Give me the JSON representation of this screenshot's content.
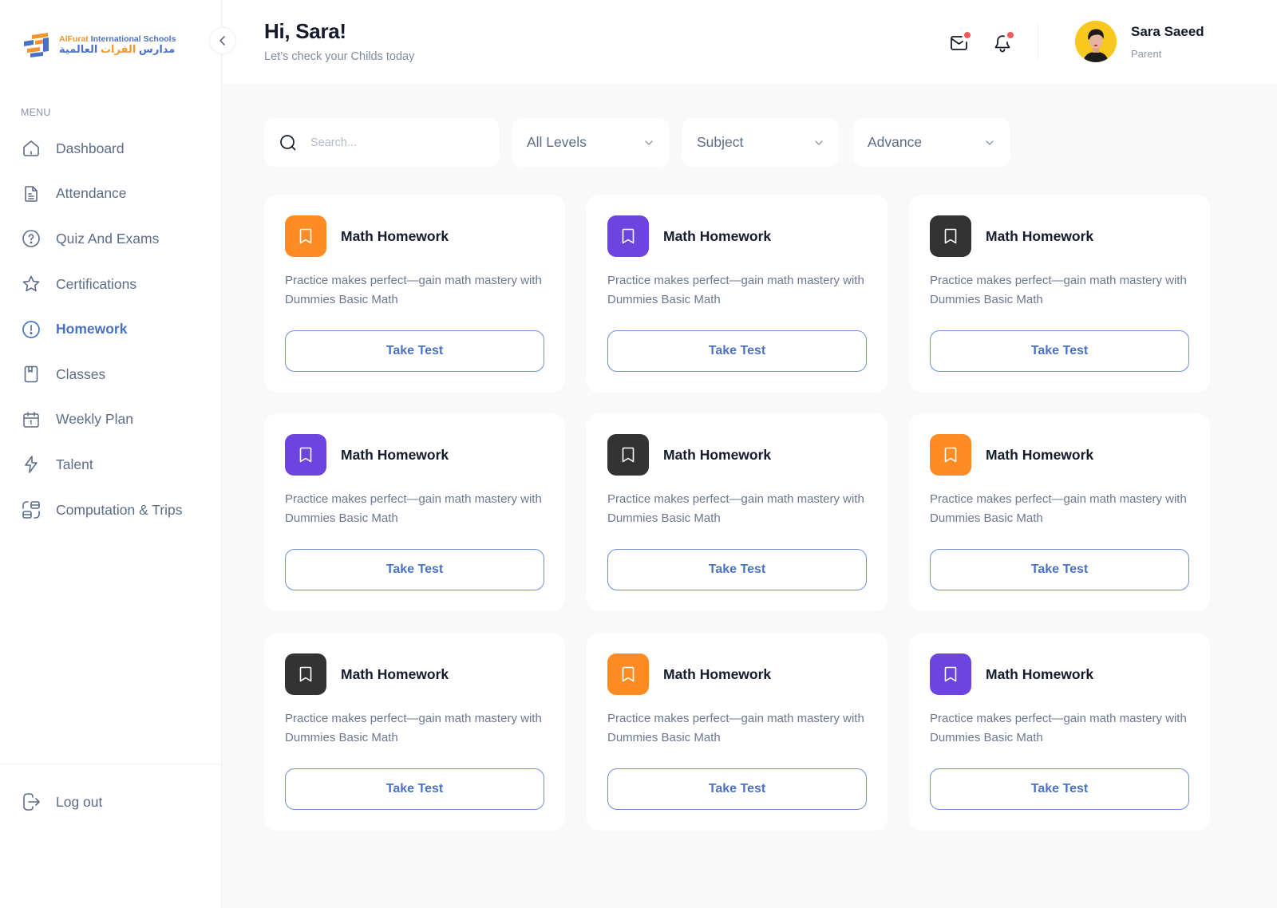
{
  "brand": {
    "name_en_accent": "AlFurat",
    "name_en_rest": " International Schools",
    "name_ar_start": "مدارس ",
    "name_ar_accent": "الفرات",
    "name_ar_end": " العالمية",
    "colors": {
      "blue": "#4A72C4",
      "orange": "#F3962B"
    }
  },
  "sidebar": {
    "menu_label": "MENU",
    "items": [
      {
        "label": "Dashboard",
        "icon": "home-icon",
        "active": false
      },
      {
        "label": "Attendance",
        "icon": "document-icon",
        "active": false
      },
      {
        "label": "Quiz And Exams",
        "icon": "question-circle-icon",
        "active": false
      },
      {
        "label": "Certifications",
        "icon": "star-icon",
        "active": false
      },
      {
        "label": "Homework",
        "icon": "alert-circle-icon",
        "active": true
      },
      {
        "label": "Classes",
        "icon": "book-bookmark-icon",
        "active": false
      },
      {
        "label": "Weekly Plan",
        "icon": "calendar-icon",
        "active": false
      },
      {
        "label": "Talent",
        "icon": "lightning-icon",
        "active": false
      },
      {
        "label": "Computation & Trips",
        "icon": "layout-grid-icon",
        "active": false
      }
    ],
    "logout_label": "Log out"
  },
  "header": {
    "greeting": "Hi, Sara!",
    "subtitle": "Let’s check your Childs today",
    "user": {
      "name": "Sara Saeed",
      "role": "Parent"
    },
    "notifications": {
      "mail_unread": true,
      "bell_unread": true
    }
  },
  "filters": {
    "search_placeholder": "Search...",
    "search_value": "",
    "levels": "All Levels",
    "subject": "Subject",
    "advance": "Advance"
  },
  "colors": {
    "accent": "#4A72C4",
    "orange": "#FF8C22",
    "purple": "#6E44E0",
    "dark": "#333333",
    "badge_red": "#F15A5A"
  },
  "cards": [
    {
      "title": "Math Homework",
      "description": "Practice makes perfect—gain math mastery with Dummies Basic Math",
      "button": "Take Test",
      "tile_color": "orange"
    },
    {
      "title": "Math Homework",
      "description": "Practice makes perfect—gain math mastery with Dummies Basic Math",
      "button": "Take Test",
      "tile_color": "purple"
    },
    {
      "title": "Math Homework",
      "description": "Practice makes perfect—gain math mastery with Dummies Basic Math",
      "button": "Take Test",
      "tile_color": "dark"
    },
    {
      "title": "Math Homework",
      "description": "Practice makes perfect—gain math mastery with Dummies Basic Math",
      "button": "Take Test",
      "tile_color": "purple"
    },
    {
      "title": "Math Homework",
      "description": "Practice makes perfect—gain math mastery with Dummies Basic Math",
      "button": "Take Test",
      "tile_color": "dark"
    },
    {
      "title": "Math Homework",
      "description": "Practice makes perfect—gain math mastery with Dummies Basic Math",
      "button": "Take Test",
      "tile_color": "orange"
    },
    {
      "title": "Math Homework",
      "description": "Practice makes perfect—gain math mastery with Dummies Basic Math",
      "button": "Take Test",
      "tile_color": "dark"
    },
    {
      "title": "Math Homework",
      "description": "Practice makes perfect—gain math mastery with Dummies Basic Math",
      "button": "Take Test",
      "tile_color": "orange"
    },
    {
      "title": "Math Homework",
      "description": "Practice makes perfect—gain math mastery with Dummies Basic Math",
      "button": "Take Test",
      "tile_color": "purple"
    }
  ]
}
